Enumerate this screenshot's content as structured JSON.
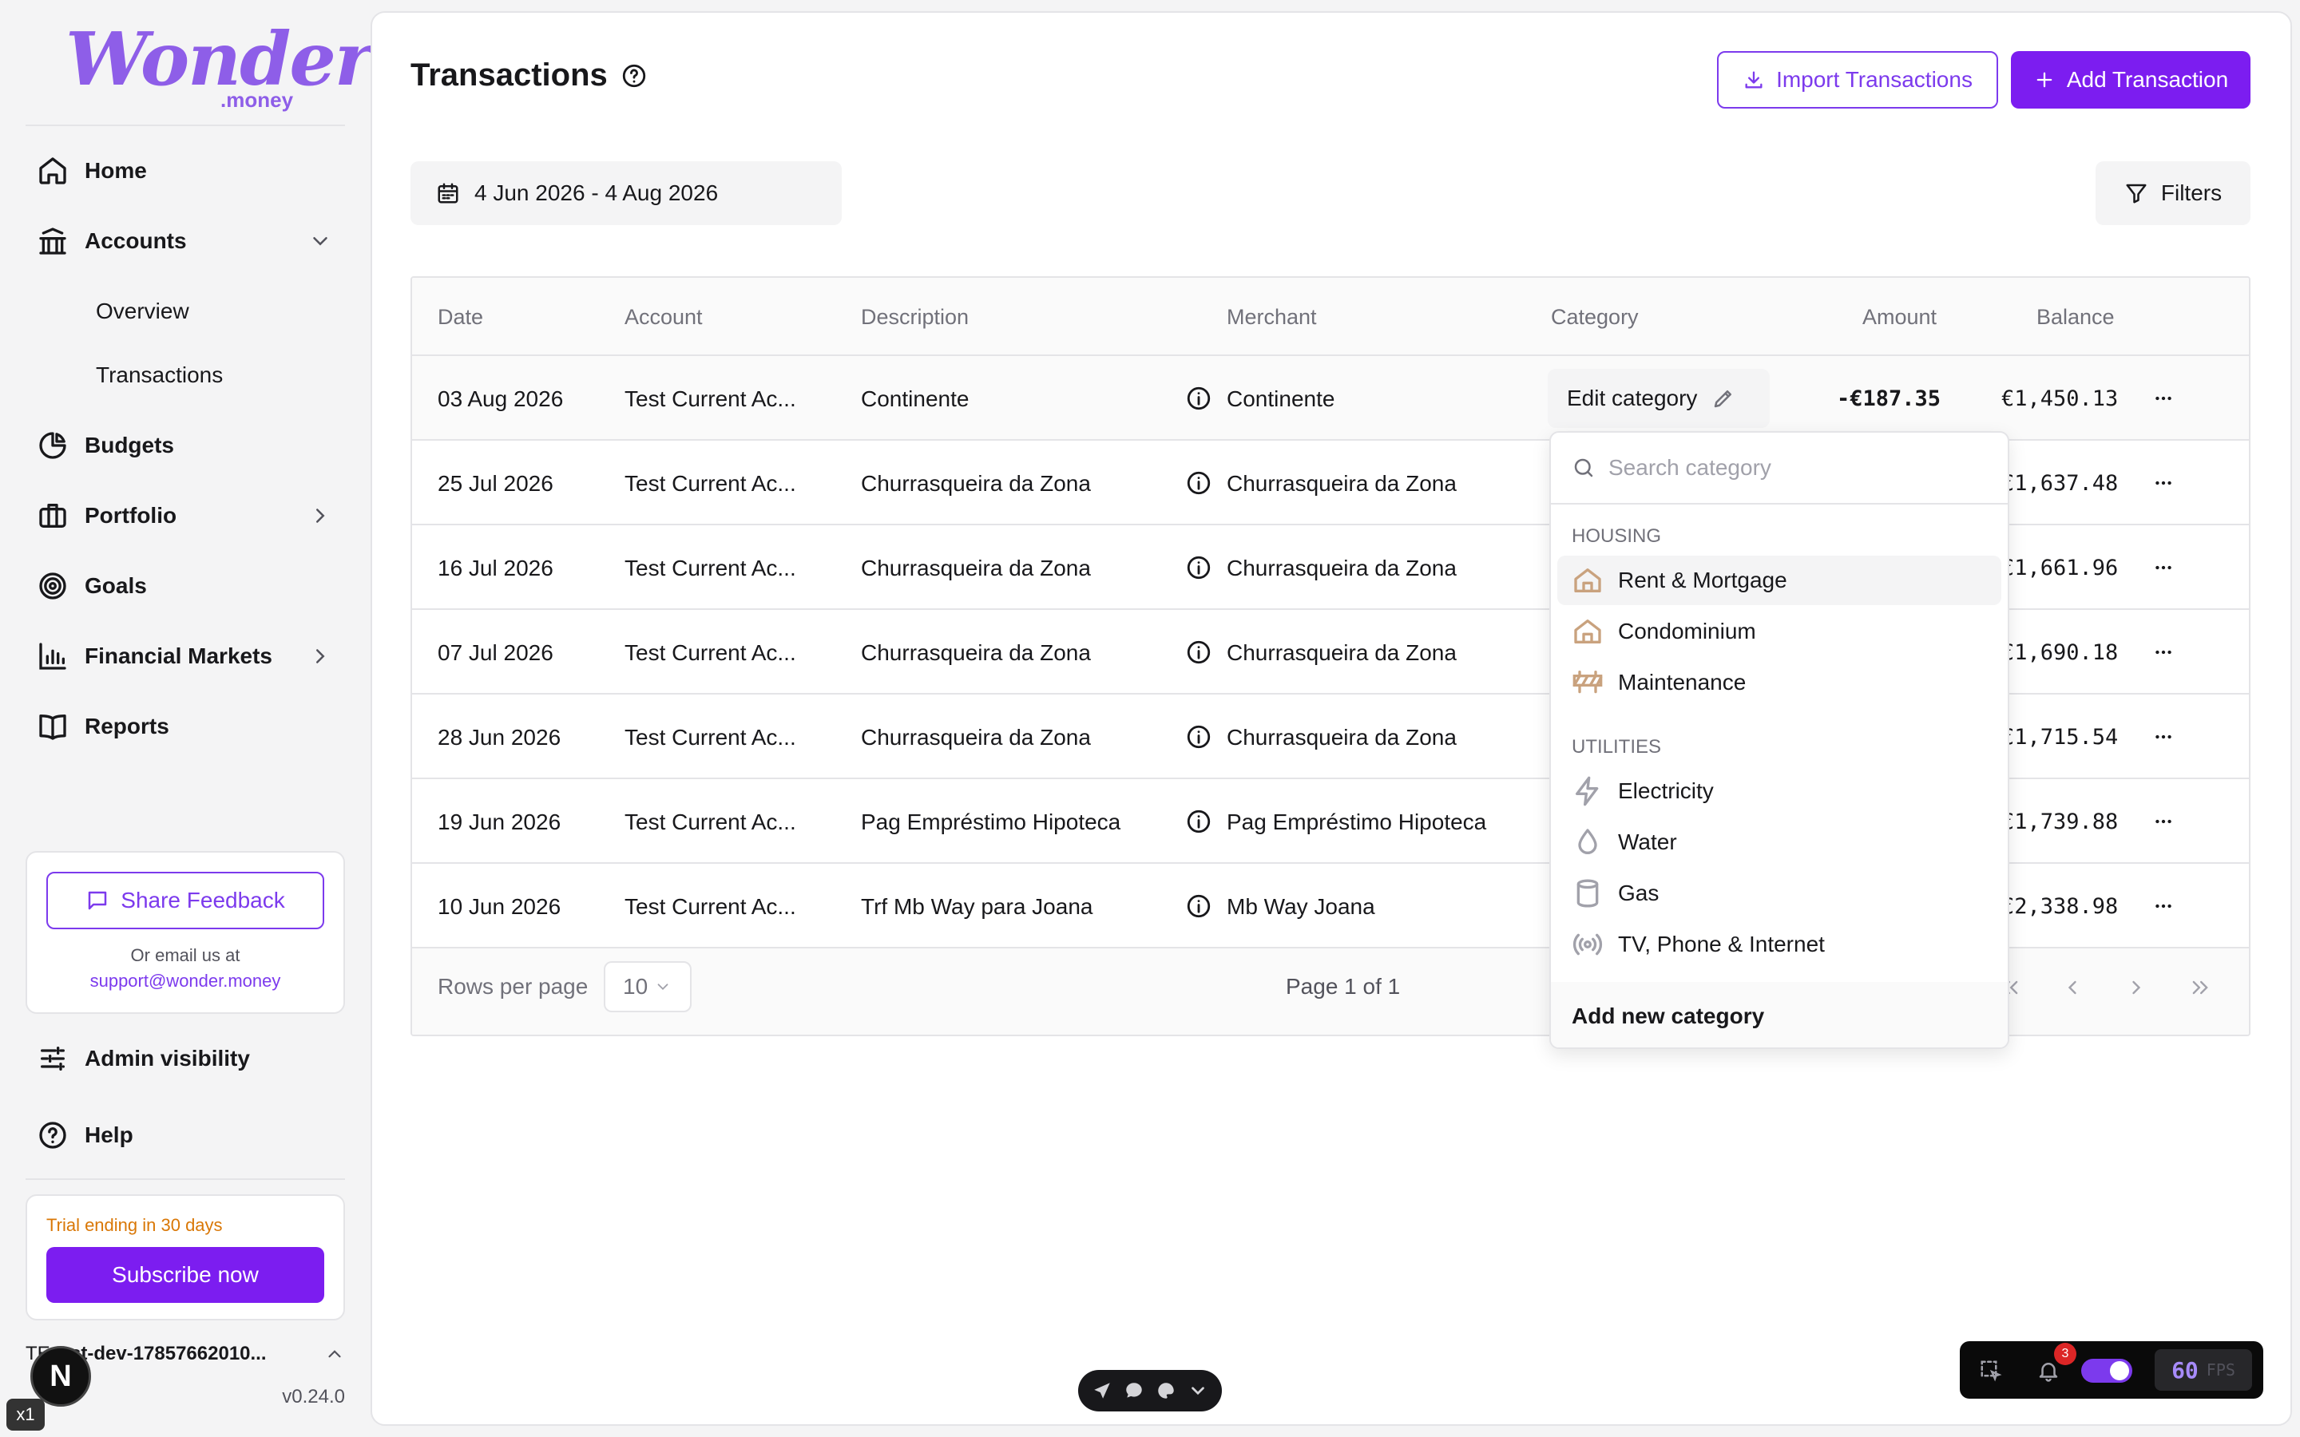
{
  "brand": {
    "logo_main": "Wonder",
    "logo_sub": ".money"
  },
  "sidebar": {
    "nav": [
      {
        "label": "Home",
        "icon": "home-icon"
      },
      {
        "label": "Accounts",
        "icon": "bank-icon",
        "expanded": true
      },
      {
        "label": "Budgets",
        "icon": "pie-chart-icon"
      },
      {
        "label": "Portfolio",
        "icon": "briefcase-icon"
      },
      {
        "label": "Goals",
        "icon": "target-icon"
      },
      {
        "label": "Financial Markets",
        "icon": "bar-chart-icon"
      },
      {
        "label": "Reports",
        "icon": "book-icon"
      }
    ],
    "accounts_sub": [
      "Overview",
      "Transactions"
    ],
    "feedback": {
      "button": "Share Feedback",
      "or_text": "Or email us at",
      "email": "support@wonder.money"
    },
    "admin_visibility": "Admin visibility",
    "help": "Help",
    "trial": {
      "text": "Trial ending in 30 days",
      "button": "Subscribe now"
    },
    "user": {
      "initials": "TE",
      "name": "test-dev-17857662010..."
    },
    "version": "v0.24.0"
  },
  "header": {
    "title": "Transactions",
    "import_button": "Import Transactions",
    "add_button": "Add Transaction",
    "date_range": "4 Jun 2026 - 4 Aug 2026",
    "filters_button": "Filters"
  },
  "table": {
    "columns": [
      "Date",
      "Account",
      "Description",
      "Merchant",
      "Category",
      "Amount",
      "Balance"
    ],
    "rows": [
      {
        "date": "03 Aug 2026",
        "account": "Test Current Ac...",
        "description": "Continente",
        "merchant": "Continente",
        "category": "Edit category",
        "amount": "-€187.35",
        "balance": "€1,450.13"
      },
      {
        "date": "25 Jul 2026",
        "account": "Test Current Ac...",
        "description": "Churrasqueira da Zona",
        "merchant": "Churrasqueira da Zona",
        "balance": "€1,637.48"
      },
      {
        "date": "16 Jul 2026",
        "account": "Test Current Ac...",
        "description": "Churrasqueira da Zona",
        "merchant": "Churrasqueira da Zona",
        "balance": "€1,661.96"
      },
      {
        "date": "07 Jul 2026",
        "account": "Test Current Ac...",
        "description": "Churrasqueira da Zona",
        "merchant": "Churrasqueira da Zona",
        "balance": "€1,690.18"
      },
      {
        "date": "28 Jun 2026",
        "account": "Test Current Ac...",
        "description": "Churrasqueira da Zona",
        "merchant": "Churrasqueira da Zona",
        "balance": "€1,715.54"
      },
      {
        "date": "19 Jun 2026",
        "account": "Test Current Ac...",
        "description": "Pag Empréstimo Hipoteca",
        "merchant": "Pag Empréstimo Hipoteca",
        "balance": "€1,739.88"
      },
      {
        "date": "10 Jun 2026",
        "account": "Test Current Ac...",
        "description": "Trf Mb Way para Joana",
        "merchant": "Mb Way Joana",
        "balance": "€2,338.98"
      }
    ],
    "footer": {
      "rows_per_page_label": "Rows per page",
      "rows_per_page_value": "10",
      "page_label": "Page 1 of 1"
    }
  },
  "category_dropdown": {
    "search_placeholder": "Search category",
    "groups": [
      {
        "label": "HOUSING",
        "items": [
          "Rent & Mortgage",
          "Condominium",
          "Maintenance"
        ]
      },
      {
        "label": "UTILITIES",
        "items": [
          "Electricity",
          "Water",
          "Gas",
          "TV, Phone & Internet"
        ]
      }
    ],
    "add_new": "Add new category"
  },
  "dev_overlay": {
    "notifications": "3",
    "fps_value": "60",
    "fps_label": "FPS",
    "x1": "x1",
    "next_letter": "N"
  },
  "colors": {
    "accent": "#7c1df0",
    "accent_outline": "#7c3aed",
    "brand_logo": "#8e5ee8",
    "trial_text": "#d97706",
    "housing_icon": "#c9a27e"
  }
}
